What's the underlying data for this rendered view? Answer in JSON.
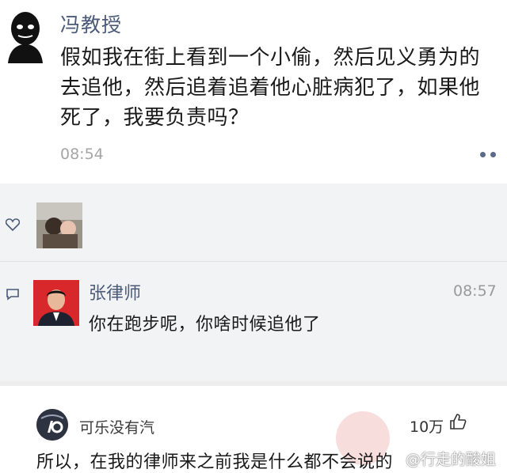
{
  "post": {
    "author": "冯教授",
    "content": "假如我在街上看到一个小偷，然后见义勇为的去追他，然后追着追着他心脏病犯了，如果他死了，我要负责吗？",
    "time": "08:54",
    "more_icon": "ellipsis-icon"
  },
  "likes": {
    "icon": "heart-icon"
  },
  "comment": {
    "icon": "comment-icon",
    "name": "张律师",
    "time": "08:57",
    "text": "你在跑步呢，你啥时候追他了"
  },
  "bottom_comment": {
    "username": "可乐没有汽",
    "like_count": "10万",
    "thumb_icon": "thumbs-up-icon",
    "text": "所以，在我的律师来之前我是什么都不会说的",
    "watermark": "@行走的酸姐"
  },
  "colors": {
    "name_blue": "#4a5a78",
    "comment_bg": "#f2f3f5"
  }
}
